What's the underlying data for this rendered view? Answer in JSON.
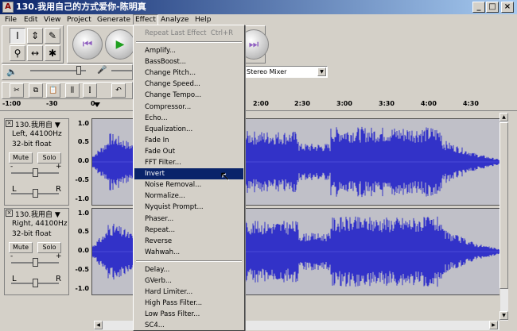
{
  "window": {
    "title": "130.我用自己的方式爱你-陈明真",
    "app_icon": "A"
  },
  "menubar": {
    "items": [
      "File",
      "Edit",
      "View",
      "Project",
      "Generate",
      "Effect",
      "Analyze",
      "Help"
    ]
  },
  "tools": {
    "select": "I",
    "envelope": "⇕",
    "draw": "✎",
    "zoom": "⚲",
    "timeshift": "↔",
    "multi": "✱"
  },
  "transport": {
    "skip_start": "⏮",
    "play": "▶",
    "skip_end": "⏭"
  },
  "input_source": {
    "value": "Stereo Mixer"
  },
  "ruler": {
    "ticks": [
      "-1:00",
      "-30",
      "0",
      "2:00",
      "2:30",
      "3:00",
      "3:30",
      "4:00",
      "4:30"
    ]
  },
  "tracks": [
    {
      "name": "130.我用自",
      "channel": "Left, 44100Hz",
      "format": "32-bit float",
      "mute": "Mute",
      "solo": "Solo",
      "gain_minus": "-",
      "gain_plus": "+",
      "pan_left": "L",
      "pan_right": "R",
      "scale": [
        "1.0",
        "0.5",
        "0.0",
        "-0.5",
        "-1.0"
      ]
    },
    {
      "name": "130.我用自",
      "channel": "Right, 44100Hz",
      "format": "32-bit float",
      "mute": "Mute",
      "solo": "Solo",
      "gain_minus": "-",
      "gain_plus": "+",
      "pan_left": "L",
      "pan_right": "R",
      "scale": [
        "1.0",
        "0.5",
        "0.0",
        "-0.5",
        "-1.0"
      ]
    }
  ],
  "effect_menu": {
    "repeat_last": "Repeat Last Effect",
    "repeat_shortcut": "Ctrl+R",
    "group1": [
      "Amplify...",
      "BassBoost...",
      "Change Pitch...",
      "Change Speed...",
      "Change Tempo...",
      "Compressor...",
      "Echo...",
      "Equalization...",
      "Fade In",
      "Fade Out",
      "FFT Filter...",
      "Invert",
      "Noise Removal...",
      "Normalize...",
      "Nyquist Prompt...",
      "Phaser...",
      "Repeat...",
      "Reverse",
      "Wahwah..."
    ],
    "group2": [
      "Delay...",
      "GVerb...",
      "Hard Limiter...",
      "High Pass Filter...",
      "Low Pass Filter...",
      "SC4..."
    ],
    "highlighted": "Invert"
  },
  "colors": {
    "waveform": "#3232c8",
    "highlight": "#0a246a",
    "title_start": "#0a246a",
    "title_end": "#a6caf0"
  }
}
